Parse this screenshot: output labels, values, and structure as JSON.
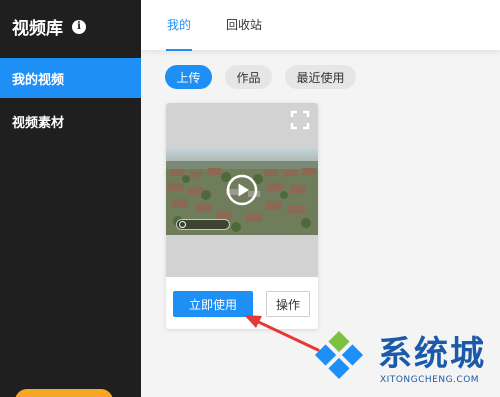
{
  "sidebar": {
    "title": "视频库",
    "items": [
      {
        "label": "我的视频",
        "active": true
      },
      {
        "label": "视频素材",
        "active": false
      }
    ]
  },
  "tabs": [
    {
      "label": "我的",
      "active": true
    },
    {
      "label": "回收站",
      "active": false
    }
  ],
  "filters": [
    {
      "label": "上传",
      "active": true
    },
    {
      "label": "作品",
      "active": false
    },
    {
      "label": "最近使用",
      "active": false
    }
  ],
  "card": {
    "use_label": "立即使用",
    "op_label": "操作"
  },
  "watermark": {
    "text": "系统城",
    "url": "XITONGCHENG.COM"
  },
  "colors": {
    "accent": "#1e8ff5",
    "sidebar_bg": "#1f1f1f",
    "annotation": "#e53935",
    "watermark": "#1a5aa8"
  },
  "icons": [
    "info-icon",
    "fullscreen-icon",
    "play-icon",
    "arrow-annotation"
  ]
}
